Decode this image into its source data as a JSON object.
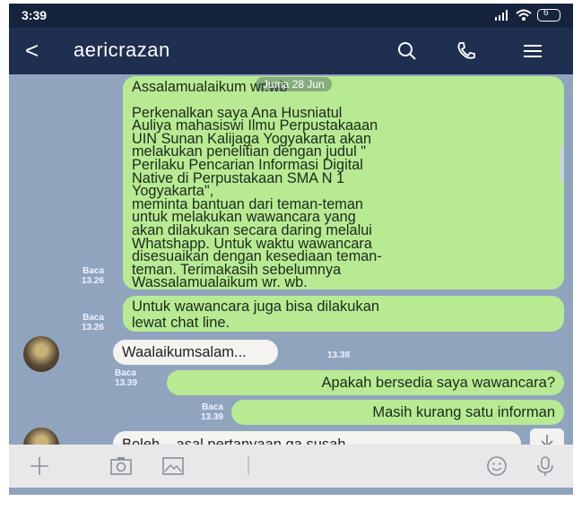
{
  "status": {
    "time": "3:39",
    "battery": "6"
  },
  "header": {
    "back": "<",
    "title": "aericrazan"
  },
  "chat": {
    "date_label": "Juma 28 Jun",
    "messages": [
      {
        "type": "sent",
        "read": "Baca",
        "time": "13.26",
        "lines": [
          "Assalamualaikum wr.wb",
          "",
          "Perkenalkan saya Ana Husniatul",
          "Auliya mahasiswi Ilmu Perpustakaaan",
          "UIN Sunan Kalijaga Yogyakarta akan",
          "melakukan penelitian dengan judul \"",
          "Perilaku Pencarian Informasi Digital",
          "Native di Perpustakaan SMA N 1",
          "Yogyakarta\",",
          "meminta bantuan dari teman-teman",
          "untuk melakukan wawancara yang",
          "akan dilakukan secara daring melalui",
          "Whatshapp. Untuk waktu wawancara",
          "disesuaikan dengan kesediaan teman-",
          "teman. Terimakasih sebelumnya",
          "Wassalamualaikum wr. wb."
        ]
      },
      {
        "type": "sent",
        "read": "Baca",
        "time": "13.26",
        "lines": [
          "Untuk wawancara juga bisa dilakukan",
          "lewat chat line."
        ]
      },
      {
        "type": "received",
        "time": "13.38",
        "text": "Waalaikumsalam..."
      },
      {
        "type": "sent",
        "read": "Baca",
        "time": "13.39",
        "text": "Apakah bersedia saya wawancara?"
      },
      {
        "type": "sent",
        "read": "Baca",
        "time": "13.39",
        "text": "Masih kurang satu informan"
      },
      {
        "type": "received",
        "text": "Boleh... asal pertanyaan ga susah"
      }
    ]
  },
  "colors": {
    "sent": "#b8ea93",
    "received": "#f5f3f0",
    "header": "#1f2f4f",
    "chat_bg": "#90a4be"
  }
}
